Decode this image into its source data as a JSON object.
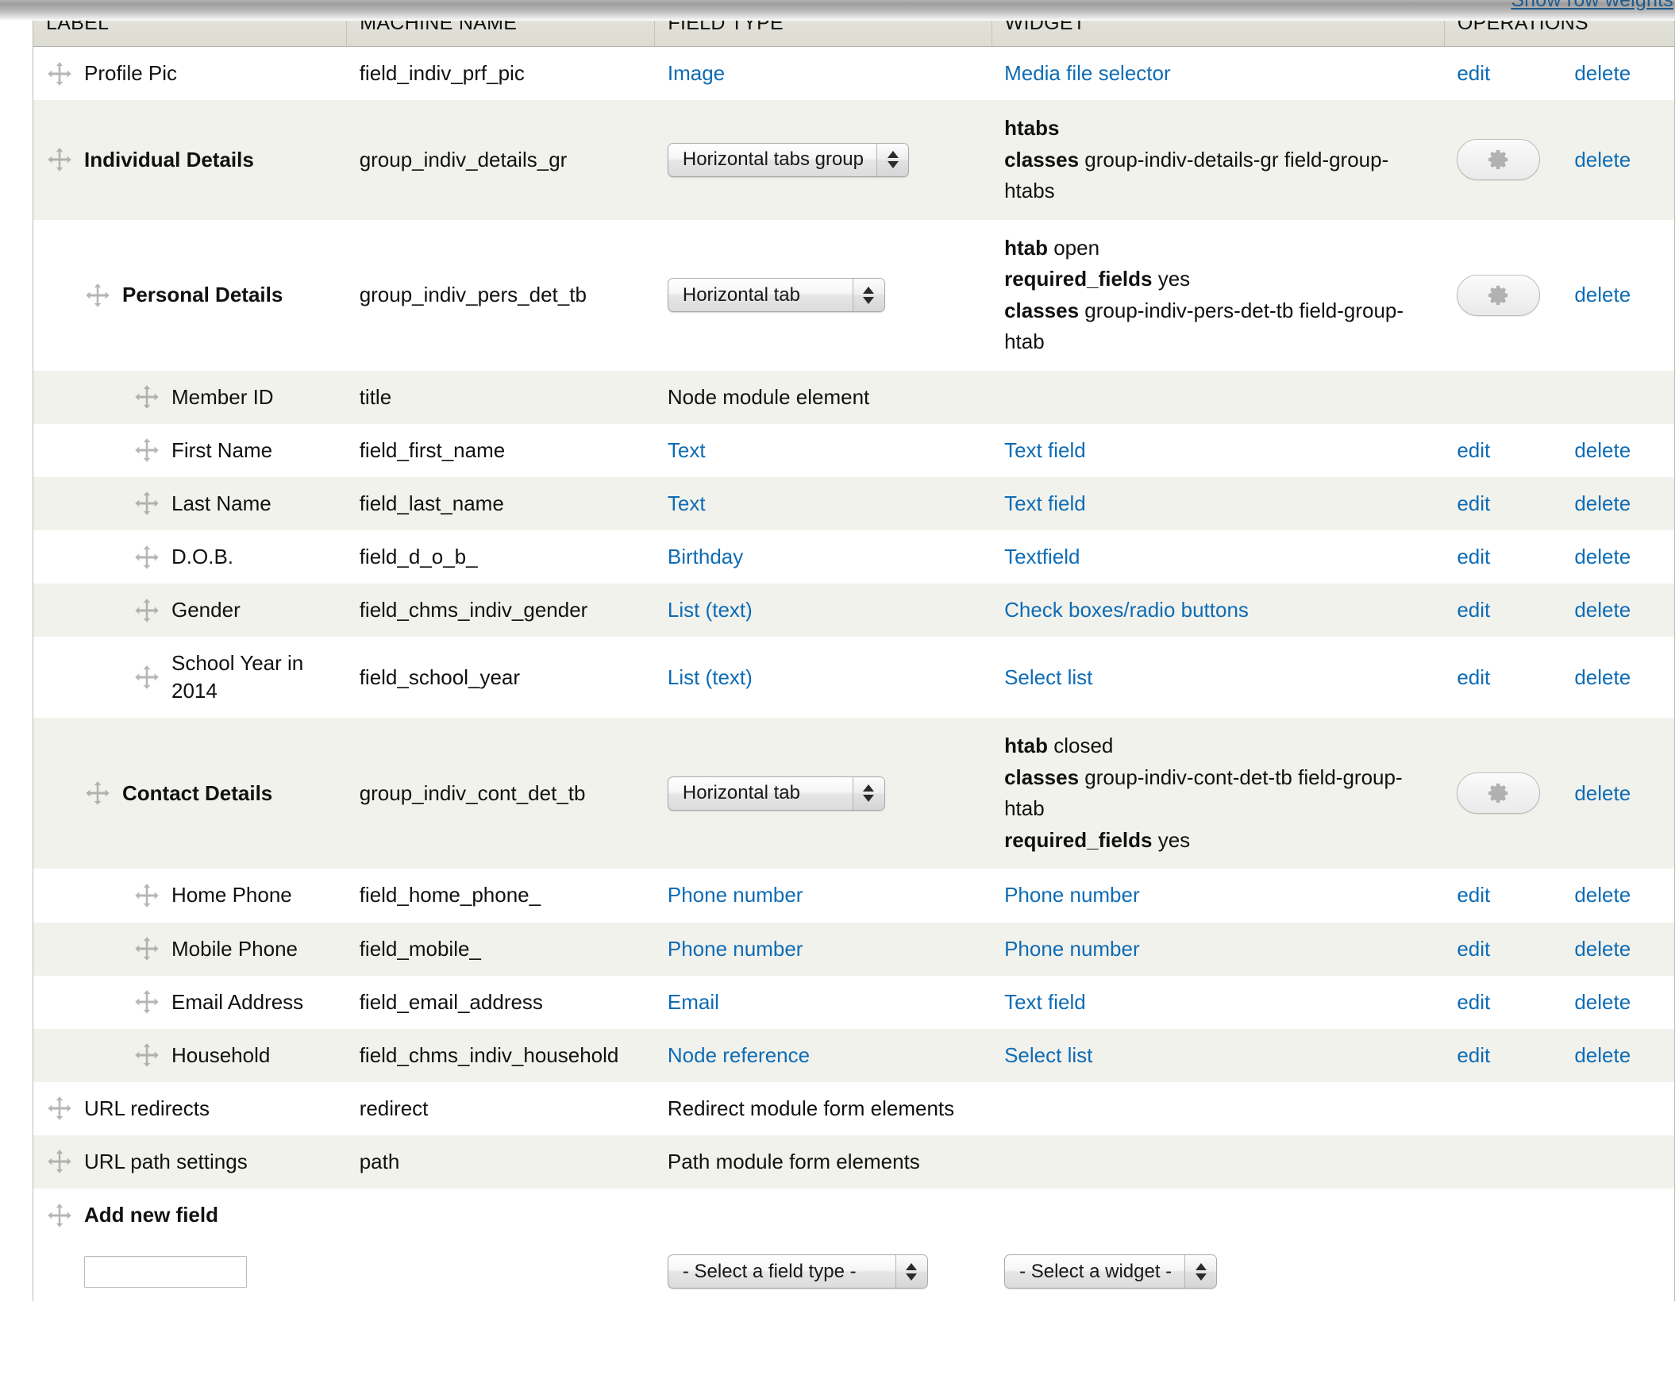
{
  "toolbar": {
    "show_row_weights": "Show row weights"
  },
  "table": {
    "columns": [
      "LABEL",
      "MACHINE NAME",
      "FIELD TYPE",
      "WIDGET",
      "OPERATIONS"
    ],
    "rows": [
      {
        "label": "Profile Pic",
        "machine_name": "field_indiv_prf_pic",
        "field_type": "Image",
        "field_type_link": true,
        "widget": "Media file selector",
        "widget_link": true,
        "edit": "edit",
        "delete": "delete",
        "indent": 0,
        "bold": false,
        "stripe": "odd"
      },
      {
        "label": "Individual Details",
        "machine_name": "group_indiv_details_gr",
        "select_value": "Horizontal tabs group",
        "widget_meta": [
          {
            "key": "htabs",
            "value": ""
          },
          {
            "key": "classes",
            "value": "group-indiv-details-gr field-group-htabs"
          }
        ],
        "gear": true,
        "delete": "delete",
        "indent": 0,
        "bold": true,
        "stripe": "even"
      },
      {
        "label": "Personal Details",
        "machine_name": "group_indiv_pers_det_tb",
        "select_value": "Horizontal tab",
        "widget_meta": [
          {
            "key": "htab",
            "value": "open"
          },
          {
            "key": "required_fields",
            "value": "yes"
          },
          {
            "key": "classes",
            "value": "group-indiv-pers-det-tb field-group-htab"
          }
        ],
        "gear": true,
        "delete": "delete",
        "indent": 1,
        "bold": true,
        "stripe": "odd"
      },
      {
        "label": "Member ID",
        "machine_name": "title",
        "field_type": "Node module element",
        "field_type_link": false,
        "widget": "",
        "widget_link": false,
        "edit": "",
        "delete": "",
        "indent": 2,
        "bold": false,
        "stripe": "even"
      },
      {
        "label": "First Name",
        "machine_name": "field_first_name",
        "field_type": "Text",
        "field_type_link": true,
        "widget": "Text field",
        "widget_link": true,
        "edit": "edit",
        "delete": "delete",
        "indent": 2,
        "bold": false,
        "stripe": "odd"
      },
      {
        "label": "Last Name",
        "machine_name": "field_last_name",
        "field_type": "Text",
        "field_type_link": true,
        "widget": "Text field",
        "widget_link": true,
        "edit": "edit",
        "delete": "delete",
        "indent": 2,
        "bold": false,
        "stripe": "even"
      },
      {
        "label": "D.O.B.",
        "machine_name": "field_d_o_b_",
        "field_type": "Birthday",
        "field_type_link": true,
        "widget": "Textfield",
        "widget_link": true,
        "edit": "edit",
        "delete": "delete",
        "indent": 2,
        "bold": false,
        "stripe": "odd"
      },
      {
        "label": "Gender",
        "machine_name": "field_chms_indiv_gender",
        "field_type": "List (text)",
        "field_type_link": true,
        "widget": "Check boxes/radio buttons",
        "widget_link": true,
        "edit": "edit",
        "delete": "delete",
        "indent": 2,
        "bold": false,
        "stripe": "even"
      },
      {
        "label": "School Year in 2014",
        "machine_name": "field_school_year",
        "field_type": "List (text)",
        "field_type_link": true,
        "widget": "Select list",
        "widget_link": true,
        "edit": "edit",
        "delete": "delete",
        "indent": 2,
        "bold": false,
        "stripe": "odd"
      },
      {
        "label": "Contact Details",
        "machine_name": "group_indiv_cont_det_tb",
        "select_value": "Horizontal tab",
        "widget_meta": [
          {
            "key": "htab",
            "value": "closed"
          },
          {
            "key": "classes",
            "value": "group-indiv-cont-det-tb field-group-htab"
          },
          {
            "key": "required_fields",
            "value": "yes"
          }
        ],
        "gear": true,
        "delete": "delete",
        "indent": 1,
        "bold": true,
        "stripe": "even"
      },
      {
        "label": "Home Phone",
        "machine_name": "field_home_phone_",
        "field_type": "Phone number",
        "field_type_link": true,
        "widget": "Phone number",
        "widget_link": true,
        "edit": "edit",
        "delete": "delete",
        "indent": 2,
        "bold": false,
        "stripe": "odd"
      },
      {
        "label": "Mobile Phone",
        "machine_name": "field_mobile_",
        "field_type": "Phone number",
        "field_type_link": true,
        "widget": "Phone number",
        "widget_link": true,
        "edit": "edit",
        "delete": "delete",
        "indent": 2,
        "bold": false,
        "stripe": "even"
      },
      {
        "label": "Email Address",
        "machine_name": "field_email_address",
        "field_type": "Email",
        "field_type_link": true,
        "widget": "Text field",
        "widget_link": true,
        "edit": "edit",
        "delete": "delete",
        "indent": 2,
        "bold": false,
        "stripe": "odd"
      },
      {
        "label": "Household",
        "machine_name": "field_chms_indiv_household",
        "field_type": "Node reference",
        "field_type_link": true,
        "widget": "Select list",
        "widget_link": true,
        "edit": "edit",
        "delete": "delete",
        "indent": 2,
        "bold": false,
        "stripe": "even"
      },
      {
        "label": "URL redirects",
        "machine_name": "redirect",
        "field_type": "Redirect module form elements",
        "field_type_link": false,
        "widget": "",
        "widget_link": false,
        "edit": "",
        "delete": "",
        "indent": 0,
        "bold": false,
        "stripe": "odd"
      },
      {
        "label": "URL path settings",
        "machine_name": "path",
        "field_type": "Path module form elements",
        "field_type_link": false,
        "widget": "",
        "widget_link": false,
        "edit": "",
        "delete": "",
        "indent": 0,
        "bold": false,
        "stripe": "even"
      }
    ],
    "add_new_field": {
      "label": "Add new field",
      "name_input_value": "",
      "field_type_select": "- Select a field type -",
      "widget_select": "- Select a widget -"
    }
  }
}
